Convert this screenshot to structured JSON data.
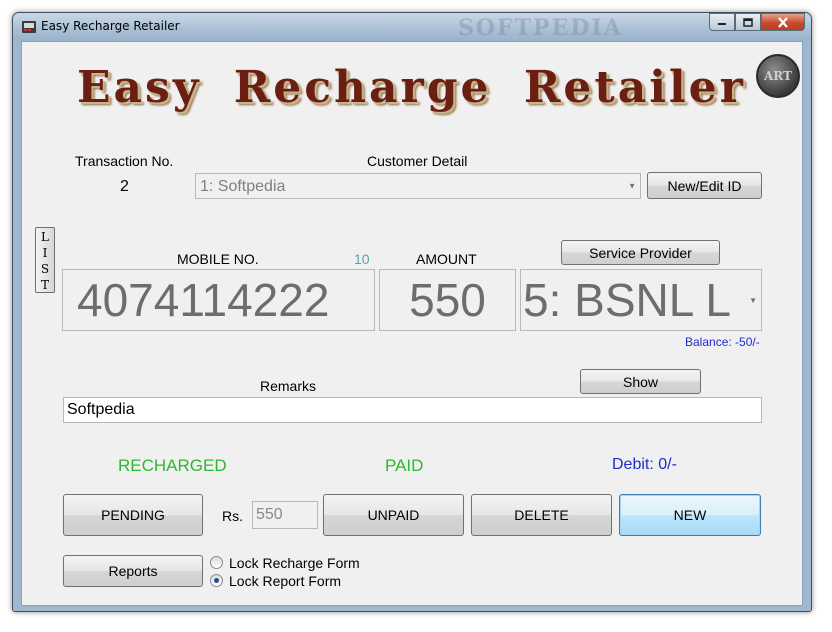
{
  "window": {
    "title": "Easy Recharge Retailer",
    "watermark": "SOFTPEDIA"
  },
  "logo": {
    "text": "Easy Recharge Retailer",
    "badge": "ART"
  },
  "transaction": {
    "label": "Transaction No.",
    "value": "2"
  },
  "customer": {
    "label": "Customer Detail",
    "selected": "1: Softpedia",
    "edit_button": "New/Edit ID"
  },
  "list_tab": {
    "letters": [
      "L",
      "I",
      "S",
      "T"
    ]
  },
  "mobile": {
    "label": "MOBILE NO.",
    "digit_count": "10",
    "value": "4074114222"
  },
  "amount": {
    "label": "AMOUNT",
    "value": "550"
  },
  "provider": {
    "button": "Service Provider",
    "selected": "5: BSNL L",
    "balance": "Balance: -50/-"
  },
  "remarks": {
    "label": "Remarks",
    "value": "Softpedia",
    "show_button": "Show"
  },
  "status": {
    "recharge": "RECHARGED",
    "payment": "PAID",
    "debit": "Debit: 0/-"
  },
  "actions": {
    "pending": "PENDING",
    "rs_label": "Rs.",
    "rs_value": "550",
    "unpaid": "UNPAID",
    "delete": "DELETE",
    "new": "NEW",
    "reports": "Reports"
  },
  "lock_options": [
    {
      "label": "Lock Recharge Form",
      "checked": false
    },
    {
      "label": "Lock Report Form",
      "checked": true
    }
  ],
  "colors": {
    "recharged": "#2eb82e",
    "paid": "#2eb82e",
    "debit": "#1f2bd0",
    "balance": "#1f2bd0",
    "digit_count": "#5aa0b0",
    "logo": "#6b1f12"
  }
}
